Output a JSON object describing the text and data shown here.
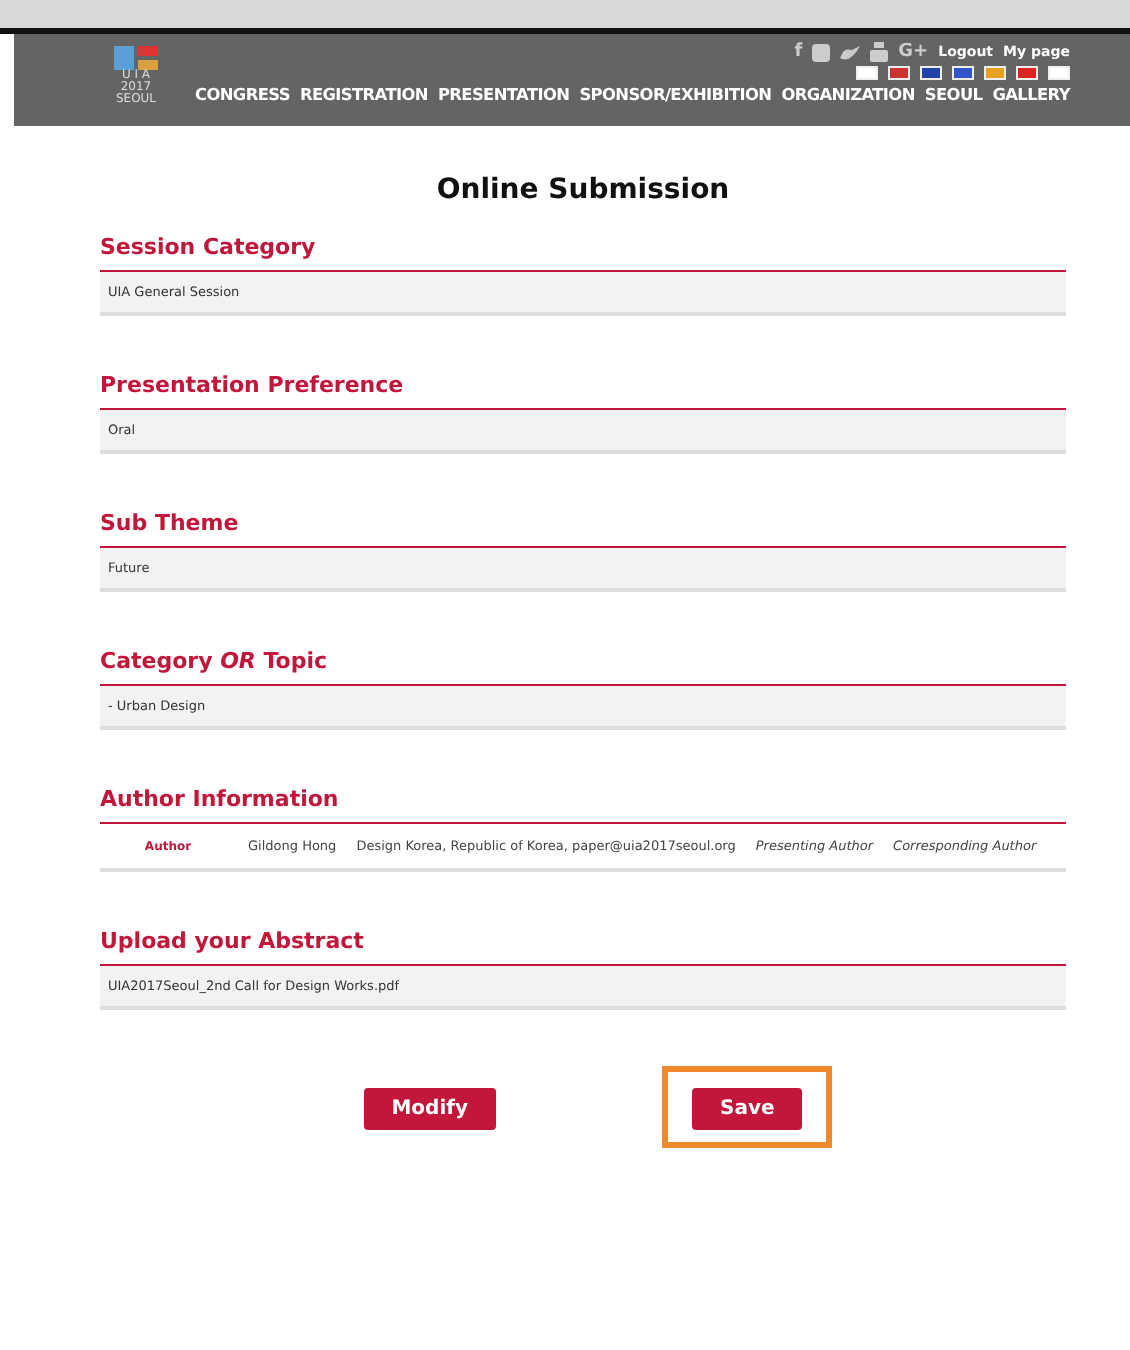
{
  "header": {
    "logo": {
      "lines": [
        "U I A",
        "2017",
        "SEOUL"
      ]
    },
    "social": [
      "f",
      "G+"
    ],
    "links": [
      "Logout",
      "My page"
    ],
    "nav": [
      "CONGRESS",
      "REGISTRATION",
      "PRESENTATION",
      "SPONSOR/EXHIBITION",
      "ORGANIZATION",
      "SEOUL",
      "GALLERY"
    ]
  },
  "title": "Online Submission",
  "sections": [
    {
      "kind": "field",
      "heading": "Session Category",
      "value": "UIA General Session"
    },
    {
      "kind": "field",
      "heading": "Presentation Preference",
      "value": "Oral"
    },
    {
      "kind": "field",
      "heading": "Sub Theme",
      "value": "Future"
    },
    {
      "kind": "field",
      "heading": "Category *OR* Topic",
      "value": "- Urban Design"
    },
    {
      "kind": "author",
      "heading": "Author Information",
      "role": "Author",
      "name": "Gildong Hong",
      "details": "Design Korea, Republic of Korea, paper@uia2017seoul.org",
      "tags": [
        "Presenting Author",
        "Corresponding Author"
      ]
    },
    {
      "kind": "field",
      "heading": "Upload your Abstract",
      "value": "UIA2017Seoul_2nd Call for Design Works.pdf"
    }
  ],
  "buttons": [
    {
      "label": "Modify",
      "highlighted": false
    },
    {
      "label": "Save",
      "highlighted": true
    }
  ]
}
